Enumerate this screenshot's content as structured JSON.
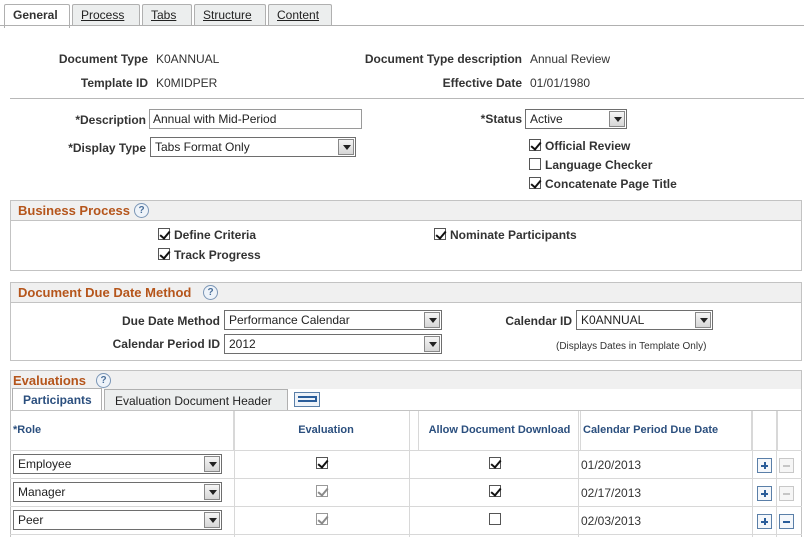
{
  "tabs": [
    {
      "label": "General",
      "active": true
    },
    {
      "label": "Process",
      "active": false
    },
    {
      "label": "Tabs",
      "active": false
    },
    {
      "label": "Structure",
      "active": false
    },
    {
      "label": "Content",
      "active": false
    }
  ],
  "header": {
    "doc_type_label": "Document Type",
    "doc_type_value": "K0ANNUAL",
    "doc_type_desc_label": "Document Type description",
    "doc_type_desc_value": "Annual Review",
    "template_id_label": "Template ID",
    "template_id_value": "K0MIDPER",
    "eff_date_label": "Effective Date",
    "eff_date_value": "01/01/1980"
  },
  "form": {
    "description_label": "*Description",
    "description_value": "Annual with Mid-Period",
    "display_type_label": "*Display Type",
    "display_type_value": "Tabs Format Only",
    "status_label": "*Status",
    "status_value": "Active",
    "official_review_label": "Official Review",
    "language_checker_label": "Language Checker",
    "concat_title_label": "Concatenate Page Title"
  },
  "business_process": {
    "title": "Business Process",
    "define_criteria_label": "Define Criteria",
    "track_progress_label": "Track Progress",
    "nominate_label": "Nominate Participants"
  },
  "due_date": {
    "title": "Document Due Date Method",
    "method_label": "Due Date Method",
    "method_value": "Performance Calendar",
    "period_label": "Calendar Period ID",
    "period_value": "2012",
    "calendar_label": "Calendar ID",
    "calendar_value": "K0ANNUAL",
    "note": "(Displays Dates in Template Only)"
  },
  "evaluations": {
    "title": "Evaluations",
    "tab_participants": "Participants",
    "tab_header": "Evaluation Document Header",
    "col_role": "*Role",
    "col_evaluation": "Evaluation",
    "col_download": "Allow Document Download",
    "col_due": "Calendar Period Due Date",
    "rows": [
      {
        "role": "Employee",
        "due": "01/20/2013"
      },
      {
        "role": "Manager",
        "due": "02/17/2013"
      },
      {
        "role": "Peer",
        "due": "02/03/2013"
      }
    ]
  },
  "icons": {
    "help": "help-icon",
    "grid_view": "grid-view-icon",
    "add_row": "add-row-icon",
    "delete_row": "delete-row-icon"
  },
  "colors": {
    "section_title": "#b5551b",
    "grid_header": "#2b4f7e"
  }
}
